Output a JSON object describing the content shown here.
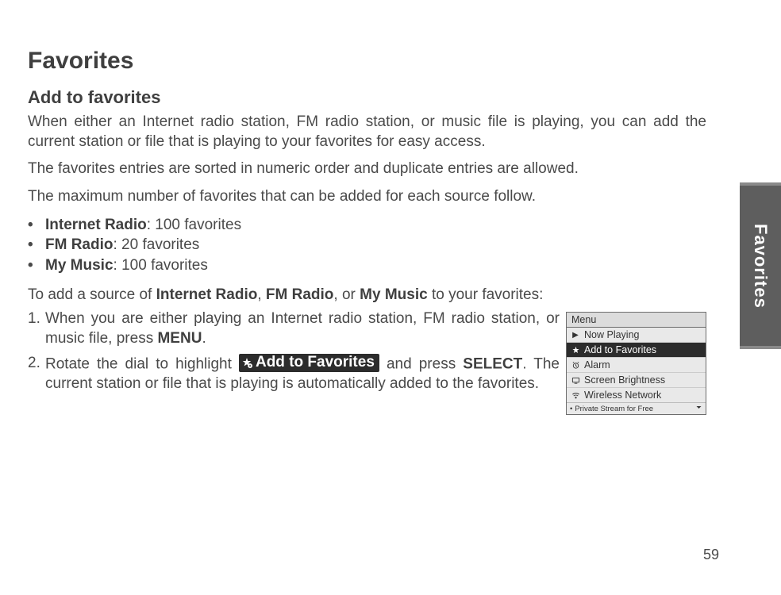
{
  "sidebar": {
    "label": "Favorites"
  },
  "page": {
    "title": "Favorites",
    "section_title": "Add to favorites",
    "para1": "When either an Internet radio station, FM radio station, or music file is playing, you can add the current station or file that is playing to your favorites for easy access.",
    "para2": "The favorites entries are sorted in numeric order and duplicate entries are allowed.",
    "para3": "The maximum number of favorites that can be added for each source follow.",
    "bullets": [
      {
        "label": "Internet Radio",
        "value": ": 100 favorites"
      },
      {
        "label": "FM Radio",
        "value": ": 20 favorites"
      },
      {
        "label": "My Music",
        "value": ": 100 favorites"
      }
    ],
    "instructions_lead_pre": "To add a source of ",
    "instructions_lead_b1": "Internet Radio",
    "instructions_lead_sep1": ", ",
    "instructions_lead_b2": "FM Radio",
    "instructions_lead_sep2": ", or ",
    "instructions_lead_b3": "My Music",
    "instructions_lead_post": " to your favorites:",
    "step1_pre": "When you are either playing an Internet radio station, FM radio station, or music file, press ",
    "step1_b": "MENU",
    "step1_post": ".",
    "step2_pre": "Rotate the dial to highlight ",
    "step2_badge": "Add to Favorites",
    "step2_mid": " and press ",
    "step2_b": "SELECT",
    "step2_post": ". The current station or file that is playing is automatically added to the favorites.",
    "page_number": "59"
  },
  "menu": {
    "header": "Menu",
    "items": [
      {
        "icon": "play-icon",
        "label": "Now Playing",
        "selected": false
      },
      {
        "icon": "star-add-icon",
        "label": "Add to Favorites",
        "selected": true
      },
      {
        "icon": "alarm-icon",
        "label": "Alarm",
        "selected": false
      },
      {
        "icon": "brightness-icon",
        "label": "Screen Brightness",
        "selected": false
      },
      {
        "icon": "wireless-icon",
        "label": "Wireless Network",
        "selected": false
      }
    ],
    "footer_left": "Private Stream for Free"
  }
}
